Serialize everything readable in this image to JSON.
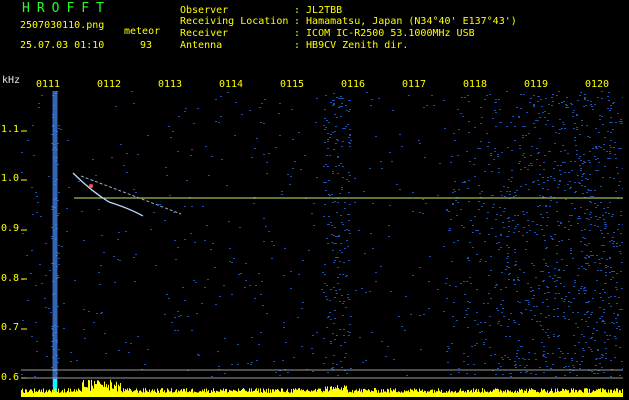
{
  "header": {
    "app_name": "HROFFT",
    "filename": "2507030110.png",
    "type_label": "meteor",
    "timestamp": "25.07.03 01:10",
    "count": "93",
    "info": [
      {
        "label": "Observer",
        "value": ": JL2TBB"
      },
      {
        "label": "Receiving Location",
        "value": ": Hamamatsu, Japan (N34°40' E137°43')"
      },
      {
        "label": "Receiver",
        "value": ": ICOM IC-R2500 53.1000MHz USB"
      },
      {
        "label": "Antenna",
        "value": ": HB9CV Zenith dir."
      }
    ]
  },
  "spectrogram": {
    "y_unit": "kHz",
    "y_ticks": [
      "1.1",
      "1.0",
      "0.9",
      "0.8",
      "0.7",
      "0.6"
    ],
    "x_ticks": [
      "0111",
      "0112",
      "0113",
      "0114",
      "0115",
      "0116",
      "0117",
      "0118",
      "0119",
      "0120"
    ],
    "colors": {
      "background": "#000000",
      "noise": "#1f5fcf",
      "label_yellow": "#ffff00",
      "title_green": "#22ff22",
      "carrier_line": "#c8e86a",
      "meteor_trail": "#b8d8ff"
    }
  }
}
